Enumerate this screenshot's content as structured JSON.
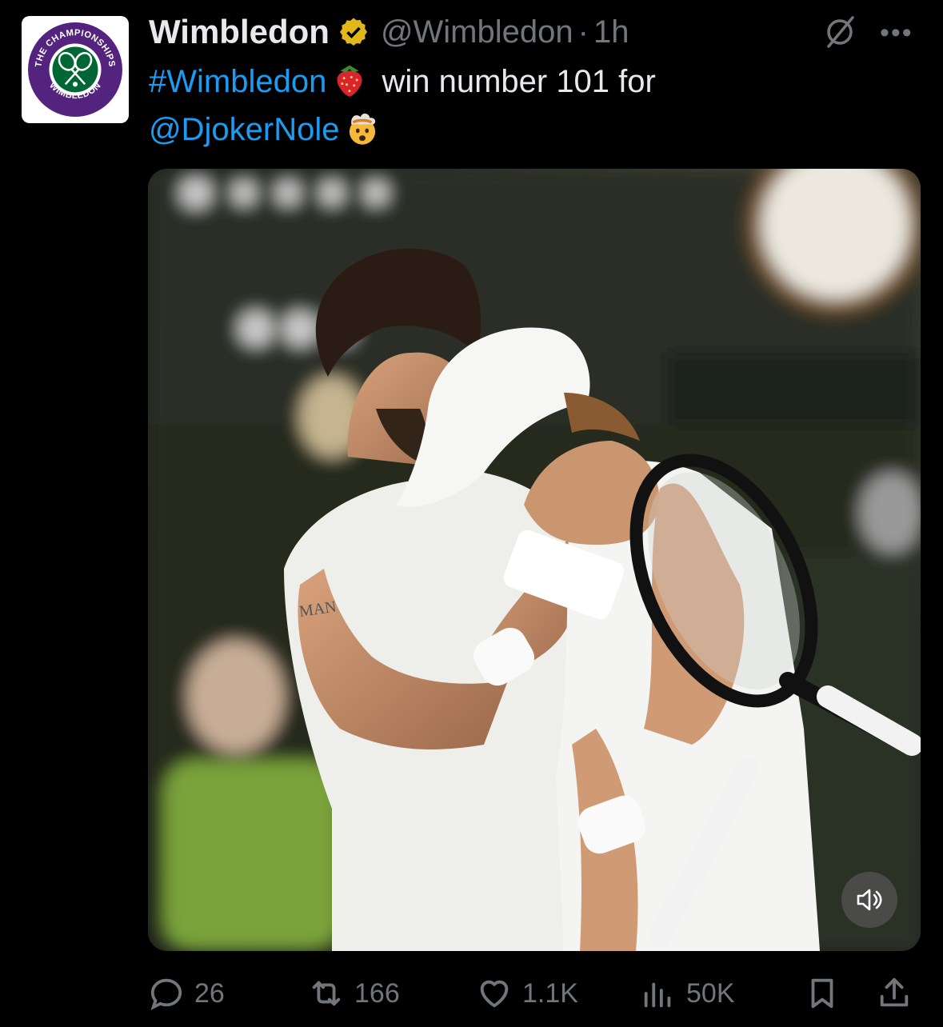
{
  "author": {
    "name": "Wimbledon",
    "handle": "@Wimbledon",
    "time": "1h",
    "logo_text_top": "THE CHAMPIONSHIPS",
    "logo_text_bottom": "WIMBLEDON"
  },
  "tweet": {
    "hashtag": "#Wimbledon",
    "text_mid": " win number 101 for",
    "mention": "@DjokerNole",
    "emoji_1": "strawberry",
    "emoji_2": "exploding-head"
  },
  "media": {
    "shirt_text": "MAN",
    "type": "video"
  },
  "actions": {
    "replies": "26",
    "reposts": "166",
    "likes": "1.1K",
    "views": "50K"
  },
  "colors": {
    "accent": "#1d9bf0",
    "muted": "#71767b",
    "verified": "#e2b719",
    "wimbledon_purple": "#54237e",
    "wimbledon_green": "#006633"
  }
}
